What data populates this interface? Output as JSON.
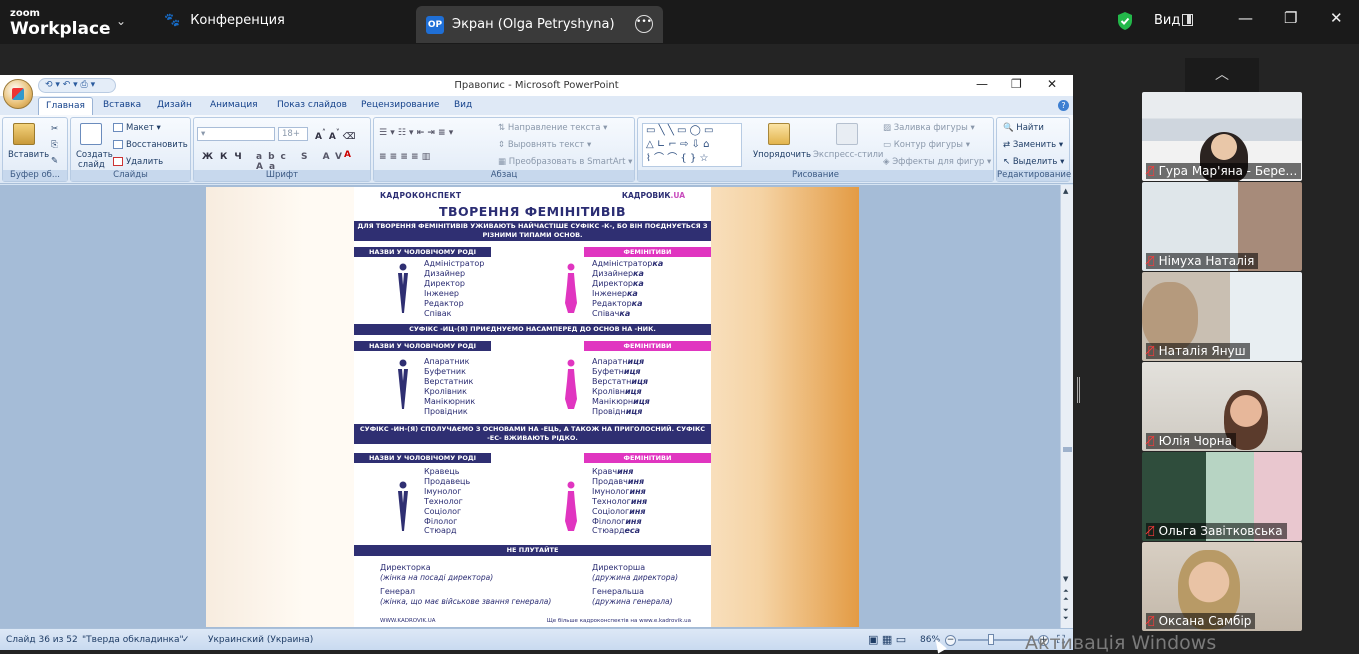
{
  "zoom": {
    "logo_top": "zoom",
    "logo_bottom": "Workplace",
    "meeting_label": "Конференция",
    "share_initials": "OP",
    "share_title": "Экран (Olga Petryshyna)",
    "view_label": "Вид",
    "participants": [
      {
        "name": "Гура Мар'яна - Бере…"
      },
      {
        "name": "Німуха Наталія"
      },
      {
        "name": "Наталія Януш"
      },
      {
        "name": "Юлія Чорна"
      },
      {
        "name": "Ольга Завітковська"
      },
      {
        "name": "Оксана Самбір"
      }
    ],
    "watermark": "Активація Windows"
  },
  "powerpoint": {
    "title": "Правопис - Microsoft PowerPoint",
    "tabs": [
      "Главная",
      "Вставка",
      "Дизайн",
      "Анимация",
      "Показ слайдов",
      "Рецензирование",
      "Вид"
    ],
    "ribbon": {
      "clipboard": {
        "paste": "Вставить",
        "group": "Буфер об..."
      },
      "slides": {
        "create": "Создать",
        "create2": "слайд",
        "layout": "Макет",
        "reset": "Восстановить",
        "delete": "Удалить",
        "group": "Слайды"
      },
      "font": {
        "size": "18+",
        "group": "Шрифт"
      },
      "paragraph": {
        "direction": "Направление текста",
        "align": "Выровнять текст",
        "smartart": "Преобразовать в SmartArt",
        "group": "Абзац"
      },
      "drawing": {
        "arrange": "Упорядочить",
        "styles": "Экспресс-стили",
        "fill": "Заливка фигуры",
        "outline": "Контур фигуры",
        "effects": "Эффекты для фигур",
        "group": "Рисование"
      },
      "editing": {
        "find": "Найти",
        "replace": "Заменить",
        "select": "Выделить",
        "group": "Редактирование"
      }
    },
    "status": {
      "slide": "Слайд 36 из 52",
      "theme": "\"Тверда обкладинка\"",
      "language": "Украинский (Украина)",
      "zoom": "86%"
    }
  },
  "slide": {
    "brand_left": "КАДРОКОНСПЕКТ",
    "brand_right_a": "КАДРОВИК",
    "brand_right_b": ".UA",
    "title": "ТВОРЕННЯ ФЕМІНІТИВІВ",
    "intro": "ДЛЯ ТВОРЕННЯ ФЕМІНІТИВІВ УЖИВАЮТЬ НАЙЧАСТІШЕ СУФІКС -К-, БО ВІН ПОЄДНУЄТЬСЯ З РІЗНИМИ ТИПАМИ ОСНОВ.",
    "male_header": "НАЗВИ У ЧОЛОВІЧОМУ РОДІ",
    "female_header": "ФЕМІНІТИВИ",
    "section1_male": [
      "Адміністратор",
      "Дизайнер",
      "Директор",
      "Інженер",
      "Редактор",
      "Співак"
    ],
    "section1_female": [
      [
        "Адміністратор",
        "ка"
      ],
      [
        "Дизайнер",
        "ка"
      ],
      [
        "Директор",
        "ка"
      ],
      [
        "Інженер",
        "ка"
      ],
      [
        "Редактор",
        "ка"
      ],
      [
        "Співач",
        "ка"
      ]
    ],
    "rule2": "СУФІКС -ИЦ-(Я) ПРИЄДНУЄМО НАСАМПЕРЕД ДО ОСНОВ НА -НИК.",
    "section2_male": [
      "Апаратник",
      "Буфетник",
      "Верстатник",
      "Кролівник",
      "Манікюрник",
      "Провідник"
    ],
    "section2_female": [
      [
        "Апаратн",
        "иця"
      ],
      [
        "Буфетн",
        "иця"
      ],
      [
        "Верстатн",
        "иця"
      ],
      [
        "Кролівн",
        "иця"
      ],
      [
        "Манікюрн",
        "иця"
      ],
      [
        "Провідн",
        "иця"
      ]
    ],
    "rule3": "СУФІКС -ИН-(Я) СПОЛУЧАЄМО З ОСНОВАМИ НА -ЕЦЬ, А ТАКОЖ НА ПРИГОЛОСНИЙ. СУФІКС -ЕС- ВЖИВАЮТЬ РІДКО.",
    "section3_male": [
      "Кравець",
      "Продавець",
      "Імунолог",
      "Технолог",
      "Соціолог",
      "Філолог",
      "Стюард"
    ],
    "section3_female": [
      [
        "Кравч",
        "иня"
      ],
      [
        "Продавч",
        "иня"
      ],
      [
        "Імунолог",
        "иня"
      ],
      [
        "Технолог",
        "иня"
      ],
      [
        "Соціолог",
        "иня"
      ],
      [
        "Філолог",
        "иня"
      ],
      [
        "Стюард",
        "еса"
      ]
    ],
    "dont_confuse": "НЕ ПЛУТАЙТЕ",
    "pairs": [
      {
        "a": "Директорка",
        "a_note": "(жінка на посаді директора)",
        "b": "Директорша",
        "b_note": "(дружина директора)"
      },
      {
        "a": "Генерал",
        "a_note": "(жінка, що має військове звання генерала)",
        "b": "Генеральша",
        "b_note": "(дружина генерала)"
      }
    ],
    "footer_left": "WWW.KADROVIK.UA",
    "footer_right": "Ще більше кадроконспектів на www.e.kadrovik.ua"
  },
  "colors": {
    "navy": "#2f2f72",
    "magenta": "#e035c0"
  }
}
